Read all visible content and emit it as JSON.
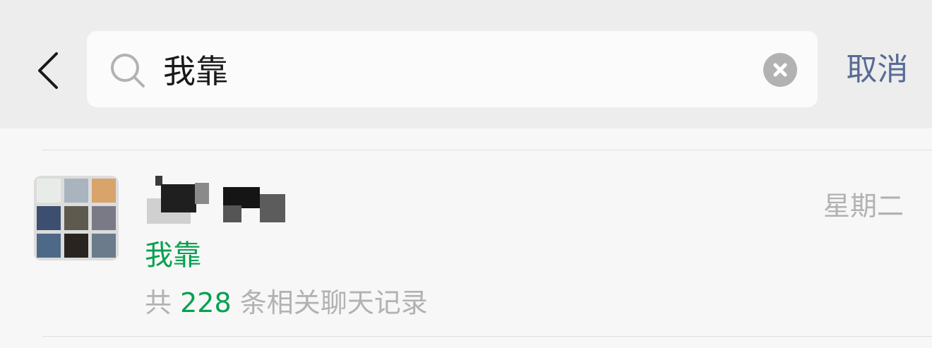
{
  "header": {
    "search_query": "我靠",
    "cancel_label": "取消"
  },
  "results": [
    {
      "date": "星期二",
      "match_text": "我靠",
      "summary_prefix": "共",
      "match_count": "228",
      "summary_suffix": "条相关聊天记录"
    }
  ],
  "colors": {
    "accent_green": "#07a14f",
    "link_blue": "#576b95",
    "secondary_gray": "#b2b2b2",
    "header_background": "#ededed"
  },
  "icons": {
    "back": "chevron-left-icon",
    "search": "search-icon",
    "clear": "clear-icon"
  }
}
